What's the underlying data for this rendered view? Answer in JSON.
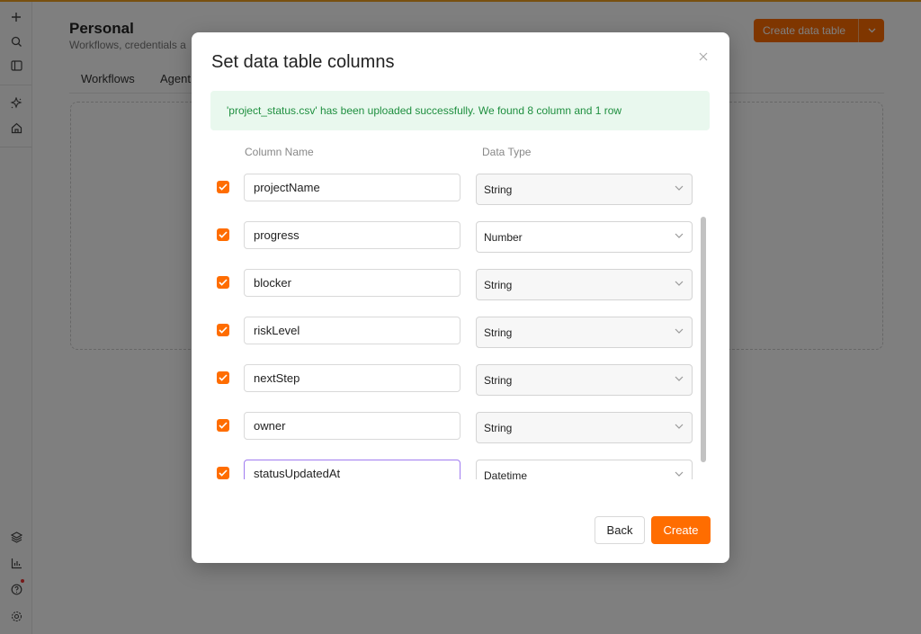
{
  "page": {
    "title": "Personal",
    "subtitle": "Workflows, credentials a",
    "tabs": [
      "Workflows",
      "Agent"
    ],
    "create_button_label": "Create data table"
  },
  "sidebar": {
    "top_icons": [
      "plus-icon",
      "search-icon",
      "panel-icon"
    ],
    "mid_icons": [
      "sparkle-icon",
      "home-icon"
    ],
    "bottom_icons": [
      "templates-icon",
      "insights-icon",
      "help-icon",
      "settings-icon"
    ]
  },
  "modal": {
    "title": "Set data table columns",
    "banner": "'project_status.csv' has been uploaded successfully. We found 8 column and 1 row",
    "column_name_header": "Column Name",
    "data_type_header": "Data Type",
    "rows": [
      {
        "name": "projectName",
        "type": "String",
        "checked": true
      },
      {
        "name": "progress",
        "type": "Number",
        "checked": true
      },
      {
        "name": "blocker",
        "type": "String",
        "checked": true
      },
      {
        "name": "riskLevel",
        "type": "String",
        "checked": true
      },
      {
        "name": "nextStep",
        "type": "String",
        "checked": true
      },
      {
        "name": "owner",
        "type": "String",
        "checked": true
      },
      {
        "name": "statusUpdatedAt",
        "type": "Datetime",
        "checked": true
      }
    ],
    "back_label": "Back",
    "create_label": "Create"
  },
  "colors": {
    "accent": "#ff6d00",
    "success_bg": "#e9f8ee",
    "success_text": "#1e8f3f",
    "focus_border": "#a07cf0"
  }
}
